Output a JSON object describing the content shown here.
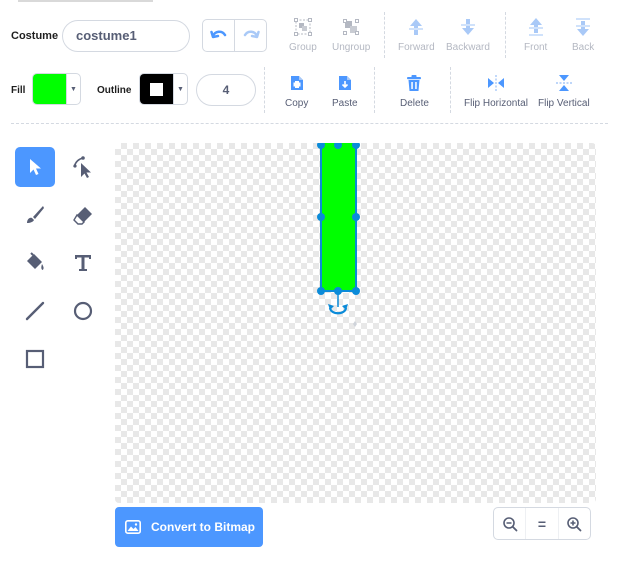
{
  "toolbar": {
    "costume_label": "Costume",
    "costume_name": "costume1",
    "group_label": "Group",
    "ungroup_label": "Ungroup",
    "forward_label": "Forward",
    "backward_label": "Backward",
    "front_label": "Front",
    "back_label": "Back"
  },
  "style_bar": {
    "fill_label": "Fill",
    "fill_color": "#00ff00",
    "outline_label": "Outline",
    "outline_color": "#000000",
    "outline_width": "4",
    "copy_label": "Copy",
    "paste_label": "Paste",
    "delete_label": "Delete",
    "flip_h_label": "Flip Horizontal",
    "flip_v_label": "Flip Vertical"
  },
  "tools": [
    {
      "name": "select",
      "active": true
    },
    {
      "name": "reshape",
      "active": false
    },
    {
      "name": "brush",
      "active": false
    },
    {
      "name": "eraser",
      "active": false
    },
    {
      "name": "fill",
      "active": false
    },
    {
      "name": "text",
      "active": false
    },
    {
      "name": "line",
      "active": false
    },
    {
      "name": "circle",
      "active": false
    },
    {
      "name": "rectangle",
      "active": false
    }
  ],
  "bottom": {
    "convert_label": "Convert to Bitmap",
    "zoom_reset_label": "="
  },
  "colors": {
    "accent": "#4c97ff",
    "shape_fill": "#00ff00",
    "selection": "#0b8bd9"
  }
}
